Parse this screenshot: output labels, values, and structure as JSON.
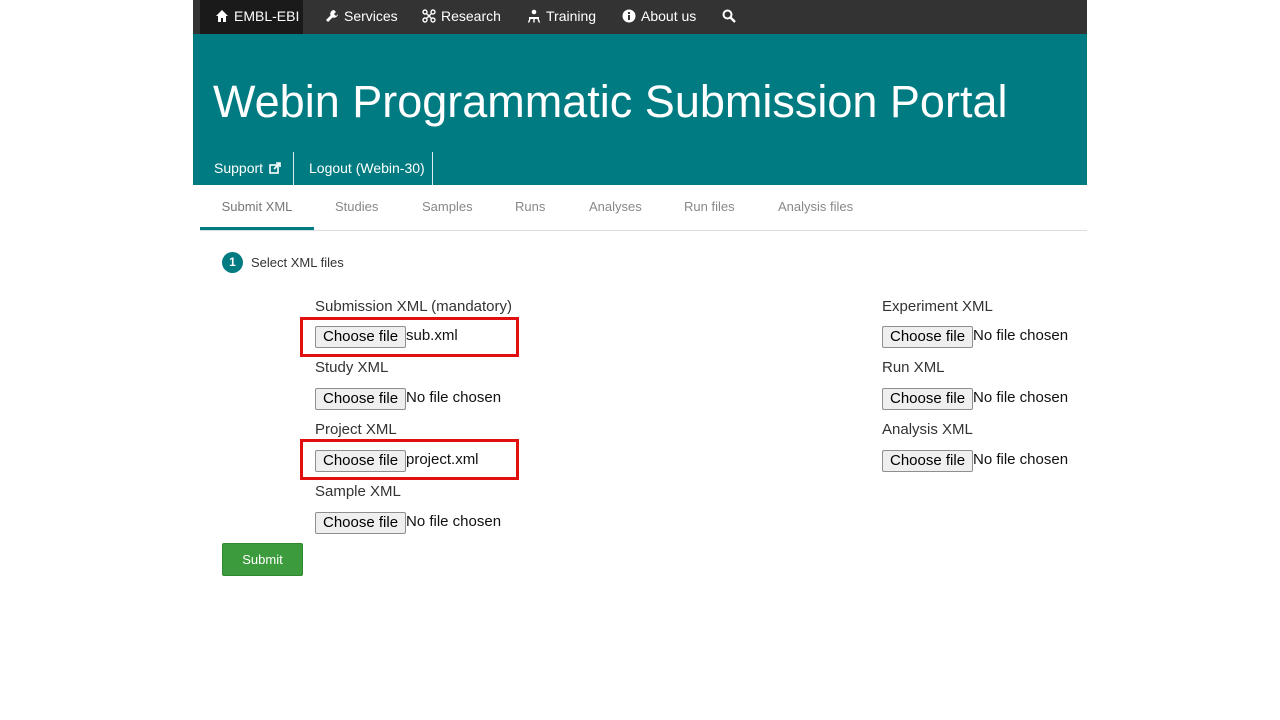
{
  "topnav": {
    "items": [
      {
        "label": "EMBL-EBI",
        "icon": "home-icon"
      },
      {
        "label": "Services",
        "icon": "wrench-icon"
      },
      {
        "label": "Research",
        "icon": "research-icon"
      },
      {
        "label": "Training",
        "icon": "training-icon"
      },
      {
        "label": "About us",
        "icon": "info-icon"
      }
    ],
    "search_icon": "search-icon"
  },
  "banner": {
    "title": "Webin Programmatic Submission Portal",
    "support_label": "Support",
    "logout_label": "Logout (Webin-30)"
  },
  "tabs": [
    "Submit XML",
    "Studies",
    "Samples",
    "Runs",
    "Analyses",
    "Run files",
    "Analysis files"
  ],
  "step": {
    "number": "1",
    "label": "Select XML files"
  },
  "choose_label": "Choose file",
  "left_fields": [
    {
      "label": "Submission XML (mandatory)",
      "file": "sub.xml"
    },
    {
      "label": "Study XML",
      "file": "No file chosen"
    },
    {
      "label": "Project XML",
      "file": "project.xml"
    },
    {
      "label": "Sample XML",
      "file": "No file chosen"
    }
  ],
  "right_fields": [
    {
      "label": "Experiment XML",
      "file": "No file chosen"
    },
    {
      "label": "Run XML",
      "file": "No file chosen"
    },
    {
      "label": "Analysis XML",
      "file": "No file chosen"
    }
  ],
  "submit_label": "Submit",
  "colors": {
    "brand": "#017b82",
    "topbar": "#333333",
    "submit": "#3c9b3c",
    "highlight": "#e01010"
  }
}
